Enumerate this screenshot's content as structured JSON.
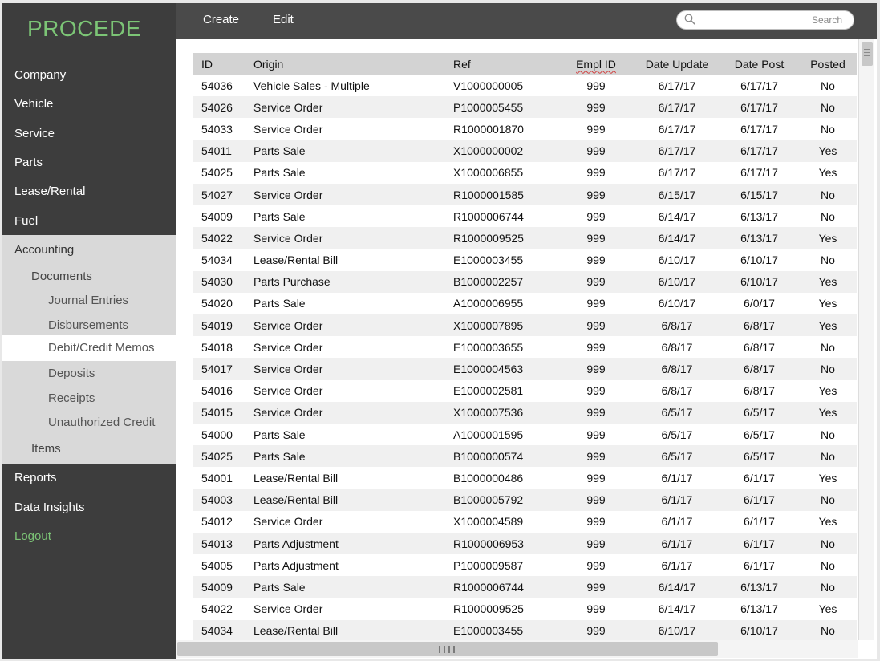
{
  "brand": "PROCEDE",
  "colors": {
    "accent_green": "#7cc576",
    "sidebar_bg": "#3d3d3d",
    "topbar_bg": "#4a4a4a",
    "submenu_bg": "#d9d9d9",
    "header_row": "#d3d3d3"
  },
  "nav": {
    "company": "Company",
    "vehicle": "Vehicle",
    "service": "Service",
    "parts": "Parts",
    "lease_rental": "Lease/Rental",
    "fuel": "Fuel",
    "accounting": "Accounting",
    "documents": "Documents",
    "journal_entries": "Journal Entries",
    "disbursements": "Disbursements",
    "debit_credit_memos": "Debit/Credit Memos",
    "deposits": "Deposits",
    "receipts": "Receipts",
    "unauthorized_credit": "Unauthorized Credit",
    "items": "Items",
    "reports": "Reports",
    "data_insights": "Data Insights",
    "logout": "Logout"
  },
  "toolbar": {
    "create": "Create",
    "edit": "Edit"
  },
  "search": {
    "placeholder": "Search",
    "icon": "search-icon"
  },
  "table": {
    "headers": {
      "id": "ID",
      "origin": "Origin",
      "ref": "Ref",
      "empl_id": "Empl ID",
      "date_update": "Date Update",
      "date_post": "Date Post",
      "posted": "Posted"
    },
    "rows": [
      [
        "54036",
        "Vehicle Sales - Multiple",
        "V1000000005",
        "999",
        "6/17/17",
        "6/17/17",
        "No"
      ],
      [
        "54026",
        "Service Order",
        "P1000005455",
        "999",
        "6/17/17",
        "6/17/17",
        "No"
      ],
      [
        "54033",
        "Service Order",
        "R1000001870",
        "999",
        "6/17/17",
        "6/17/17",
        "No"
      ],
      [
        "54011",
        "Parts Sale",
        "X1000000002",
        "999",
        "6/17/17",
        "6/17/17",
        "Yes"
      ],
      [
        "54025",
        "Parts Sale",
        "X1000006855",
        "999",
        "6/17/17",
        "6/17/17",
        "Yes"
      ],
      [
        "54027",
        "Service Order",
        "R1000001585",
        "999",
        "6/15/17",
        "6/15/17",
        "No"
      ],
      [
        "54009",
        "Parts Sale",
        "R1000006744",
        "999",
        "6/14/17",
        "6/13/17",
        "No"
      ],
      [
        "54022",
        "Service Order",
        "R1000009525",
        "999",
        "6/14/17",
        "6/13/17",
        "Yes"
      ],
      [
        "54034",
        "Lease/Rental Bill",
        "E1000003455",
        "999",
        "6/10/17",
        "6/10/17",
        "No"
      ],
      [
        "54030",
        "Parts Purchase",
        "B1000002257",
        "999",
        "6/10/17",
        "6/10/17",
        "Yes"
      ],
      [
        "54020",
        "Parts Sale",
        "A1000006955",
        "999",
        "6/10/17",
        "6/0/17",
        "Yes"
      ],
      [
        "54019",
        "Service Order",
        "X1000007895",
        "999",
        "6/8/17",
        "6/8/17",
        "Yes"
      ],
      [
        "54018",
        "Service Order",
        "E1000003655",
        "999",
        "6/8/17",
        "6/8/17",
        "No"
      ],
      [
        "54017",
        "Service Order",
        "E1000004563",
        "999",
        "6/8/17",
        "6/8/17",
        "No"
      ],
      [
        "54016",
        "Service Order",
        "E1000002581",
        "999",
        "6/8/17",
        "6/8/17",
        "Yes"
      ],
      [
        "54015",
        "Service Order",
        "X1000007536",
        "999",
        "6/5/17",
        "6/5/17",
        "Yes"
      ],
      [
        "54000",
        "Parts Sale",
        "A1000001595",
        "999",
        "6/5/17",
        "6/5/17",
        "No"
      ],
      [
        "54025",
        "Parts Sale",
        "B1000000574",
        "999",
        "6/5/17",
        "6/5/17",
        "No"
      ],
      [
        "54001",
        "Lease/Rental Bill",
        "B1000000486",
        "999",
        "6/1/17",
        "6/1/17",
        "Yes"
      ],
      [
        "54003",
        "Lease/Rental Bill",
        "B1000005792",
        "999",
        "6/1/17",
        "6/1/17",
        "No"
      ],
      [
        "54012",
        "Service Order",
        "X1000004589",
        "999",
        "6/1/17",
        "6/1/17",
        "Yes"
      ],
      [
        "54013",
        "Parts Adjustment",
        "R1000006953",
        "999",
        "6/1/17",
        "6/1/17",
        "No"
      ],
      [
        "54005",
        "Parts Adjustment",
        "P1000009587",
        "999",
        "6/1/17",
        "6/1/17",
        "No"
      ],
      [
        "54009",
        "Parts Sale",
        "R1000006744",
        "999",
        "6/14/17",
        "6/13/17",
        "No"
      ],
      [
        "54022",
        "Service Order",
        "R1000009525",
        "999",
        "6/14/17",
        "6/13/17",
        "Yes"
      ],
      [
        "54034",
        "Lease/Rental Bill",
        "E1000003455",
        "999",
        "6/10/17",
        "6/10/17",
        "No"
      ]
    ]
  }
}
